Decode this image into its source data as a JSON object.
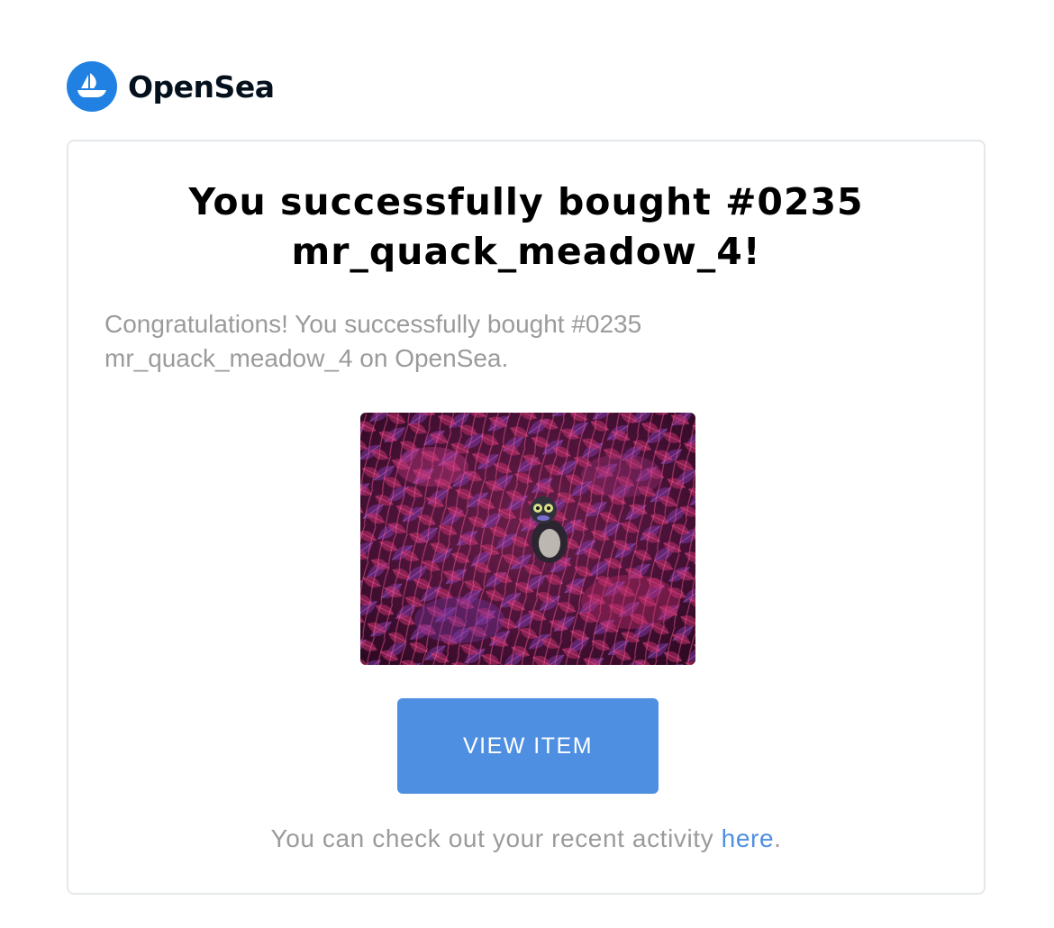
{
  "brand": {
    "name": "OpenSea",
    "logo_icon": "opensea-boat-icon",
    "logo_color": "#2081e2"
  },
  "email": {
    "title_line1": "You successfully bought #0235",
    "title_line2": "mr_quack_meadow_4!",
    "message_line1": "Congratulations! You successfully bought #0235",
    "message_line2": "mr_quack_meadow_4 on OpenSea.",
    "image_icon": "nft-artwork-image",
    "button_label": "VIEW ITEM",
    "button_color": "#4f8fe1",
    "footer_prefix": "You can check out your recent activity ",
    "footer_link": "here",
    "footer_suffix": "."
  }
}
